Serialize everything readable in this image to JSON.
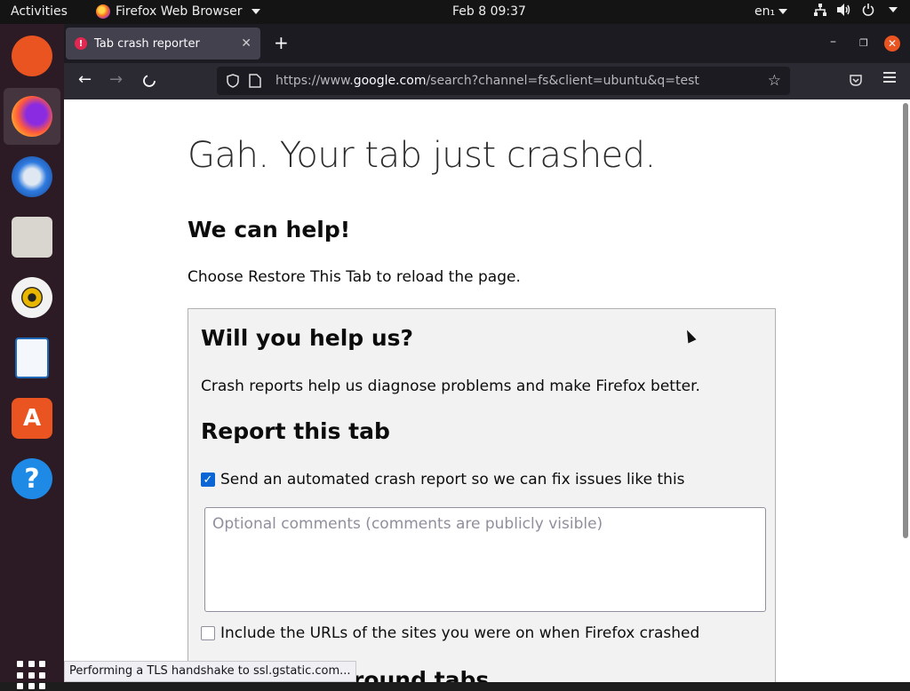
{
  "topbar": {
    "activities": "Activities",
    "app_name": "Firefox Web Browser",
    "clock": "Feb 8  09:37",
    "lang": "en₁"
  },
  "dock": {
    "items": [
      "ubuntu-logo",
      "firefox",
      "thunderbird",
      "files",
      "rhythmbox",
      "libreoffice-writer",
      "software-store",
      "help"
    ],
    "store_glyph": "A",
    "help_glyph": "?"
  },
  "browser": {
    "tab_title": "Tab crash reporter",
    "tab_error_glyph": "!",
    "url_prefix": "https://www.",
    "url_host": "google.com",
    "url_rest": "/search?channel=fs&client=ubuntu&q=test",
    "status": "Performing a TLS handshake to ssl.gstatic.com..."
  },
  "page": {
    "title": "Gah. Your tab just crashed.",
    "help_heading": "We can help!",
    "restore_text": "Choose Restore This Tab to reload the page.",
    "panel": {
      "heading": "Will you help us?",
      "description": "Crash reports help us diagnose problems and make Firefox better.",
      "report_heading": "Report this tab",
      "send_report_label": "Send an automated crash report so we can fix issues like this",
      "comments_placeholder": "Optional comments (comments are publicly visible)",
      "include_urls_label": "Include the URLs of the sites you were on when Firefox crashed",
      "partial_heading": "round tabs"
    }
  },
  "colors": {
    "accent": "#e95420",
    "checkbox": "#0a66d4"
  }
}
